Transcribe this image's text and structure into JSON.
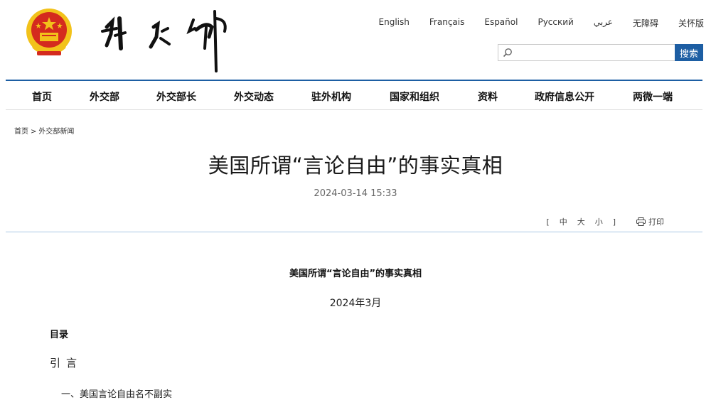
{
  "header": {
    "emblem_icon": "national-emblem-icon",
    "logo_text": "外交部",
    "languages": [
      "English",
      "Français",
      "Español",
      "Русский",
      "عربي",
      "无障碍",
      "关怀版"
    ]
  },
  "search": {
    "placeholder": "",
    "button_label": "搜索"
  },
  "nav": {
    "items": [
      "首页",
      "外交部",
      "外交部长",
      "外交动态",
      "驻外机构",
      "国家和组织",
      "资料",
      "政府信息公开",
      "两微一端"
    ]
  },
  "breadcrumb": {
    "home": "首页",
    "sep": ">",
    "current": "外交部新闻"
  },
  "article": {
    "title": "美国所谓“言论自由”的事实真相",
    "date": "2024-03-14 15:33",
    "font_size": {
      "open": "[",
      "large": "中",
      "medium": "大",
      "small": "小",
      "close": "]"
    },
    "print_label": "打印",
    "body_title": "美国所谓“言论自由”的事实真相",
    "body_date": "2024年3月",
    "toc_label": "目录",
    "intro_label": "引言",
    "section1": "一、美国言论自由名不副实"
  },
  "colors": {
    "accent": "#1d5ea3",
    "emblem_red": "#d42a1e",
    "emblem_gold": "#f2c21a"
  }
}
